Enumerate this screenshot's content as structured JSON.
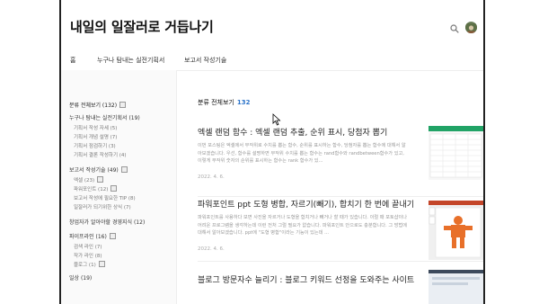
{
  "header": {
    "blog_title": "내일의 일잘러로 거듭나기",
    "search_icon": "search-icon",
    "avatar_icon": "avatar-icon"
  },
  "nav": {
    "items": [
      {
        "label": "홈"
      },
      {
        "label": "누구나 탐내는 실전기획서"
      },
      {
        "label": "보고서 작성기술"
      }
    ]
  },
  "sidebar": {
    "total": "분류 전체보기 (132)",
    "categories": [
      {
        "label": "누구나 탐내는 실전기획서 (19)",
        "subs": [
          {
            "label": "기획서 작성 자세 (5)"
          },
          {
            "label": "기획서 개념 설명 (7)"
          },
          {
            "label": "기획서 점검하기 (3)"
          },
          {
            "label": "기획서 결론 작성하기 (4)"
          }
        ]
      },
      {
        "label": "보고서 작성기술 (49)",
        "subs": [
          {
            "label": "엑셀 (23)"
          },
          {
            "label": "파워포인트 (12)"
          },
          {
            "label": "보고서 작성에 필요한 TIP (8)"
          },
          {
            "label": "일잘러가 되기위한 상식 (7)"
          }
        ]
      },
      {
        "label": "창업자가 알아야할 경영지식 (12)",
        "subs": []
      },
      {
        "label": "파이프라인 (16)",
        "subs": [
          {
            "label": "검색 라인 (7)"
          },
          {
            "label": "작가 라인 (8)"
          },
          {
            "label": "블로그 (1)"
          }
        ]
      },
      {
        "label": "일상 (19)",
        "subs": []
      }
    ]
  },
  "main": {
    "list_title": "분류 전체보기",
    "list_count": "132",
    "posts": [
      {
        "title": "엑셀 랜덤 함수 : 엑셀 랜덤 추출, 순위 표시, 당첨자 뽑기",
        "summary": "이번 포스팅은 엑셀에서 무작위로 수치를 뽑는 함수, 순위를 표시하는 함수, 당첨자를 뽑는 함수에 대해서 알아보겠습니다. 우선, 함수를 설명하면 무작위 수치를 뽑는 함수는 rand함수와 randbetween함수가 있고, 이렇게 무작위 숫자의 순위를 표시하는 함수는 rank 함수가 있...",
        "date": "2022. 4. 6."
      },
      {
        "title": "파워포인트 ppt 도형 병합, 자르기(빼기), 합치기 한 번에 끝내기",
        "summary": "파워포인트를 사용하다 보면 사진을 자르거나 도형을 합치거나 빼거나 할 때가 있습니다. 이럴 때 포토샵이나 어려운 프로그램을 생각하는데 이런 전처 그럴 필요가 없습니다. 파워포인트 안으로도 충분합니다. 그 방법에 대해서 알아보겠습니다. ppt에 \"도형 병합\"이라는 기능이 있는데 ...",
        "date": "2022. 4. 6."
      },
      {
        "title": "블로그 방문자수 늘리기 : 블로그 키워드 선정을 도와주는 사이트",
        "summary": "",
        "date": ""
      }
    ]
  },
  "colors": {
    "accent": "#2b73c9",
    "frame_border": "#222222",
    "sidebar_bg": "#fafafa",
    "thumb_excel_green": "#21a366",
    "thumb_shape_orange": "#e8702a"
  }
}
